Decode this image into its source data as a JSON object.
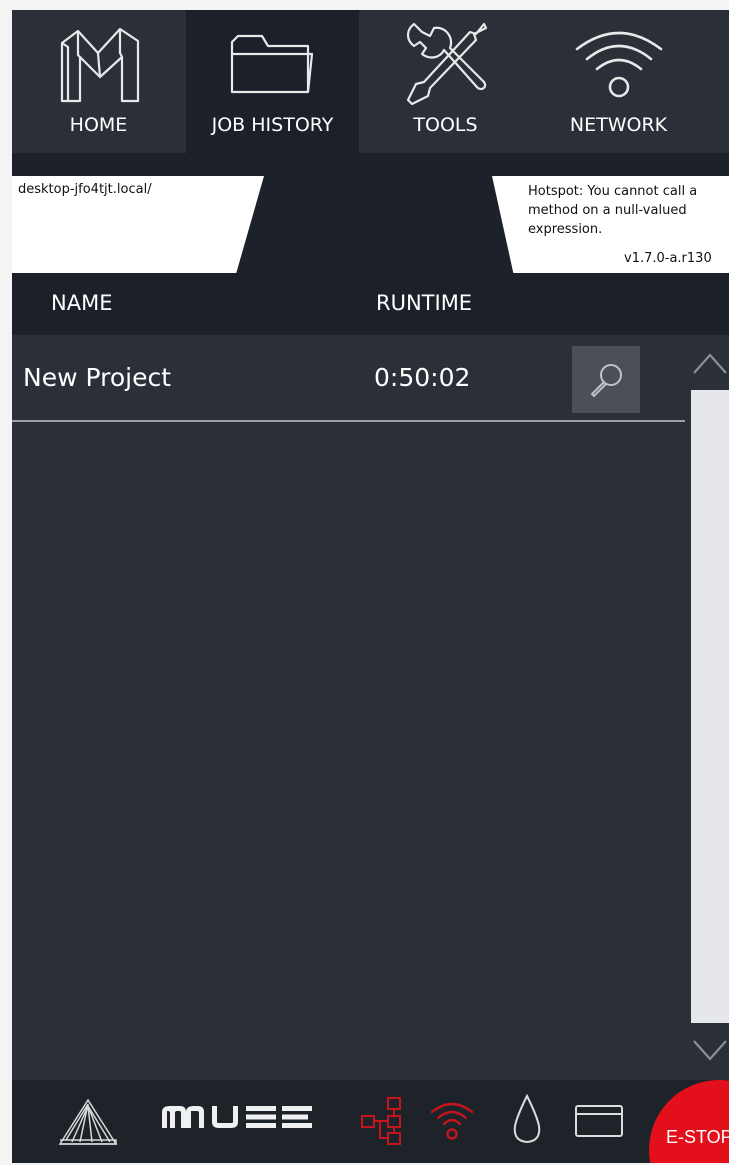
{
  "nav": {
    "tabs": [
      {
        "label": "HOME",
        "icon": "home-m-logo-icon"
      },
      {
        "label": "JOB HISTORY",
        "icon": "folder-icon",
        "active": true
      },
      {
        "label": "TOOLS",
        "icon": "tools-icon"
      },
      {
        "label": "NETWORK",
        "icon": "wifi-icon"
      }
    ]
  },
  "status": {
    "host": "desktop-jfo4tjt.local/",
    "hotspot_message": "Hotspot: You cannot call a method on a null-valued expression.",
    "version": "v1.7.0-a.r130"
  },
  "table": {
    "columns": [
      "NAME",
      "RUNTIME"
    ],
    "rows": [
      {
        "name": "New Project",
        "runtime": "0:50:02"
      }
    ]
  },
  "bottom_bar": {
    "brand": "muse",
    "icons": [
      "machine-icon",
      "network-status-icon",
      "wifi-status-icon",
      "water-drop-icon",
      "tray-icon"
    ],
    "accent_color": "#e3101c",
    "estop_label": "E-STOP"
  },
  "colors": {
    "background": "#2a2f38",
    "header": "#1b2029",
    "accent": "#e3101c"
  }
}
